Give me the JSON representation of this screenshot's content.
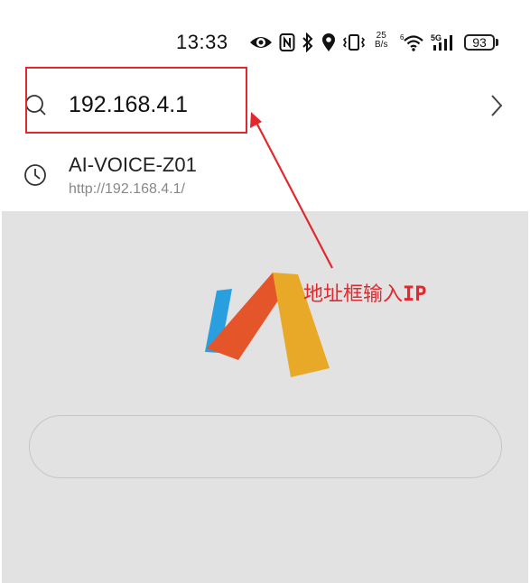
{
  "status_bar": {
    "time": "13:33",
    "net_speed_value": "25",
    "net_speed_unit": "B/s",
    "battery_level": "93",
    "icons": [
      "eye-icon",
      "nfc-icon",
      "bluetooth-icon",
      "location-icon",
      "vibrate-icon",
      "wifi-6-icon",
      "5g-signal-icon",
      "battery-icon"
    ]
  },
  "address_bar": {
    "value": "192.168.4.1",
    "icon": "search-icon",
    "go_icon": "chevron-right-icon"
  },
  "suggestion": {
    "title": "AI-VOICE-Z01",
    "url": "http://192.168.4.1/",
    "icon": "history-clock-icon"
  },
  "annotation": {
    "label_prefix": "地址框输入",
    "label_bold": "IP",
    "color": "#e0292f"
  },
  "logo": {
    "colors": {
      "blue": "#2a9fe0",
      "orange": "#e5552a",
      "yellow": "#e8a928"
    }
  }
}
